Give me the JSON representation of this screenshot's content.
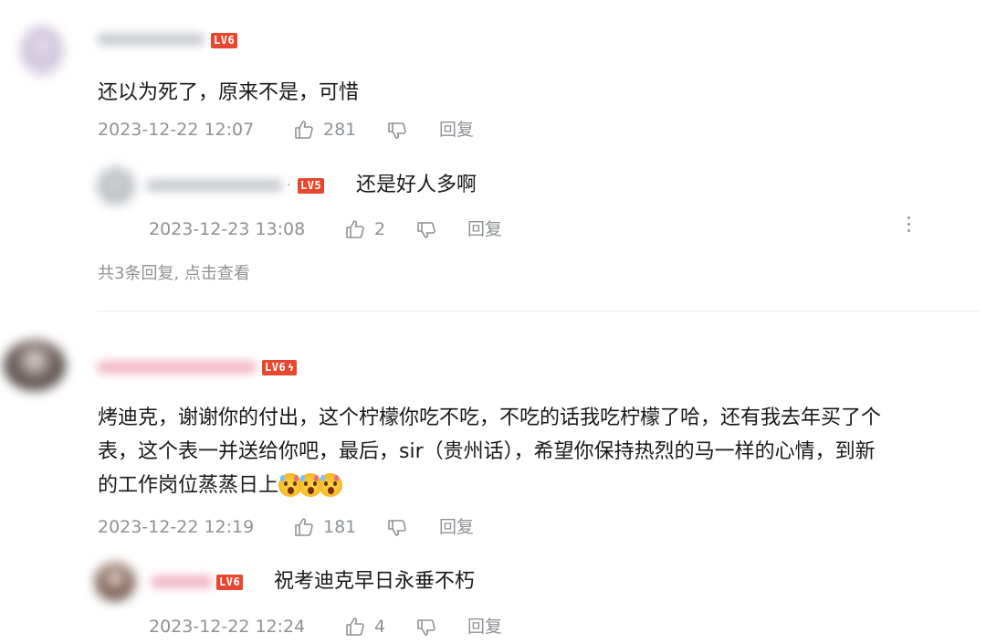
{
  "comments": [
    {
      "level": "LV6",
      "text": "还以为死了，原来不是，可惜",
      "time": "2023-12-22 12:07",
      "likes": "281",
      "reply_label": "回复",
      "replies": [
        {
          "level": "LV5",
          "text": "还是好人多啊",
          "time": "2023-12-23 13:08",
          "likes": "2",
          "reply_label": "回复"
        }
      ],
      "more_replies": "共3条回复, 点击查看"
    },
    {
      "level": "LV6",
      "text_lines": [
        "烤迪克，谢谢你的付出，这个柠檬你吃不吃，不吃的话我吃柠檬了哈，还有我去年买了个",
        "表，这个表一并送给你吧，最后，sir（贵州话），希望你保持热烈的马一样的心情，到新",
        "的工作岗位蒸蒸日上"
      ],
      "time": "2023-12-22 12:19",
      "likes": "181",
      "reply_label": "回复",
      "replies": [
        {
          "level": "LV6",
          "text": "祝考迪克早日永垂不朽",
          "time": "2023-12-22 12:24",
          "likes": "4",
          "reply_label": "回复"
        }
      ]
    }
  ],
  "colors": {
    "level_badge": "#e8472f",
    "meta_text": "#8e9296",
    "body_text": "#18191c",
    "divider": "#e6e8eb"
  },
  "icons": [
    "thumb-up-icon",
    "thumb-down-icon",
    "more-vertical-icon",
    "crying-emoji"
  ]
}
